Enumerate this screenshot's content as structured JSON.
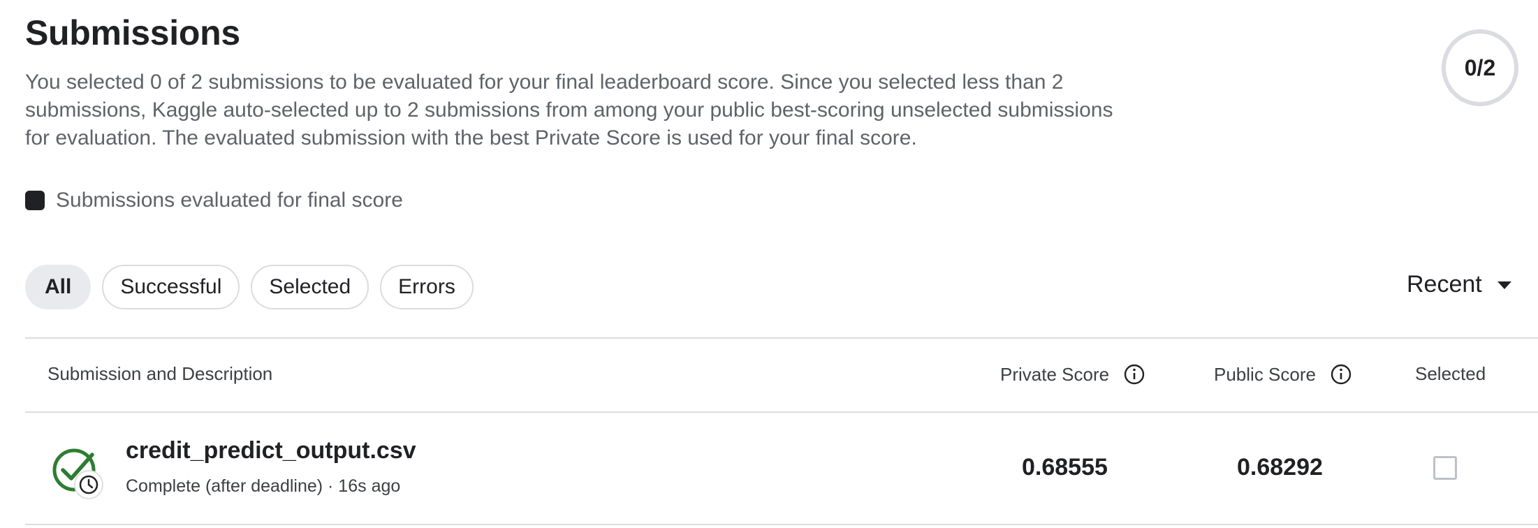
{
  "header": {
    "title": "Submissions",
    "description": "You selected 0 of 2 submissions to be evaluated for your final leaderboard score. Since you selected less than 2 submissions, Kaggle auto-selected up to 2 submissions from among your public best-scoring unselected submissions for evaluation. The evaluated submission with the best Private Score is used for your final score.",
    "selection_counter": "0/2"
  },
  "legend": {
    "label": "Submissions evaluated for final score",
    "color": "#202124"
  },
  "filters": [
    {
      "label": "All",
      "active": true
    },
    {
      "label": "Successful",
      "active": false
    },
    {
      "label": "Selected",
      "active": false
    },
    {
      "label": "Errors",
      "active": false
    }
  ],
  "sort": {
    "label": "Recent",
    "icon": "caret-down-icon"
  },
  "table": {
    "columns": {
      "submission": "Submission and Description",
      "private_score": "Private Score",
      "public_score": "Public Score",
      "selected": "Selected"
    },
    "info_icon": "info-icon",
    "rows": [
      {
        "status_icon": "check-clock-icon",
        "name": "credit_predict_output.csv",
        "meta": "Complete (after deadline) · 16s ago",
        "private_score": "0.68555",
        "public_score": "0.68292",
        "selected": false
      }
    ]
  },
  "colors": {
    "success": "#2e7d32",
    "text": "#202124",
    "muted": "#5f6368",
    "border": "#dadce0"
  }
}
